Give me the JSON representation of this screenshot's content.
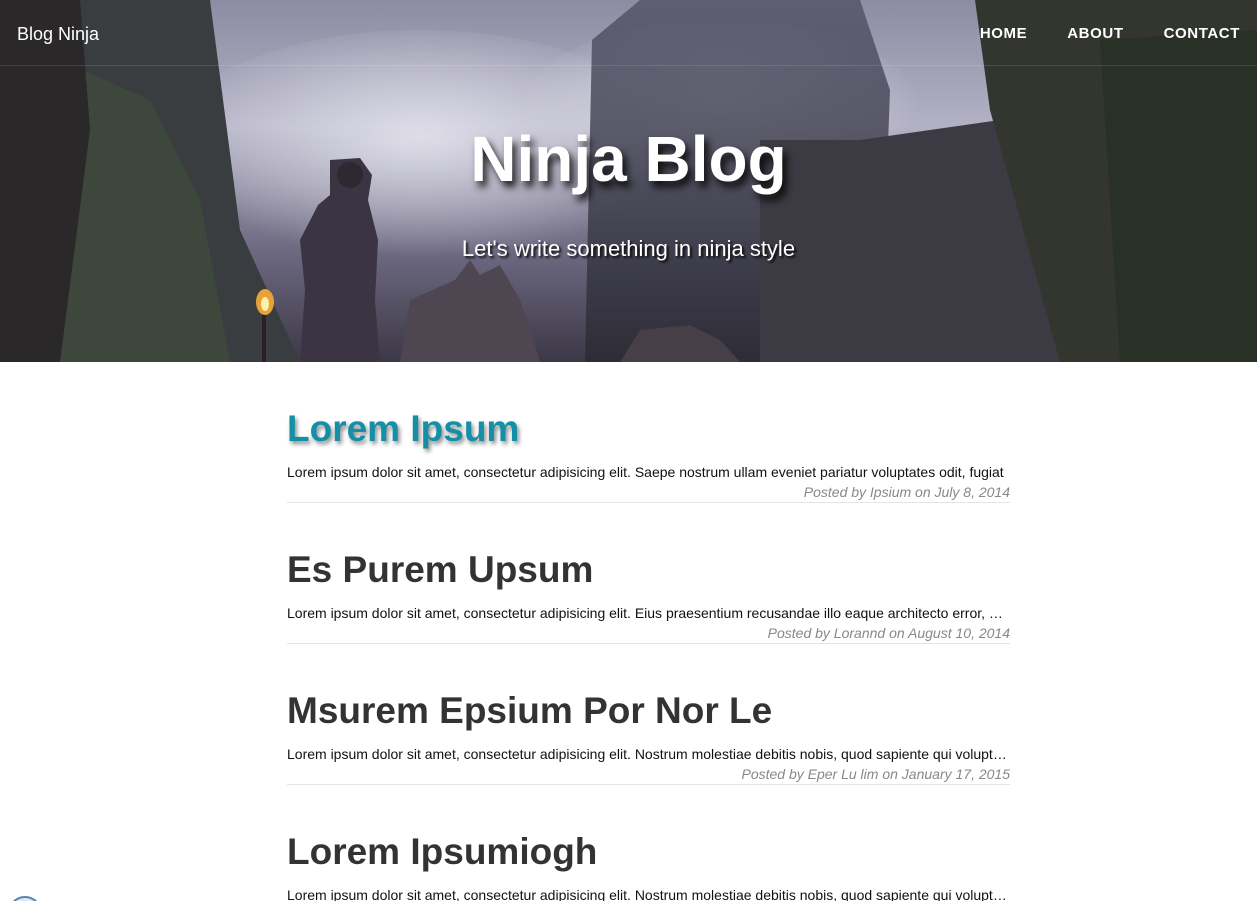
{
  "nav": {
    "brand": "Blog Ninja",
    "links": [
      "HOME",
      "ABOUT",
      "CONTACT"
    ]
  },
  "hero": {
    "title": "Ninja Blog",
    "subtitle": "Let's write something in ninja style"
  },
  "posts": [
    {
      "title": "Lorem Ipsum",
      "excerpt": "Lorem ipsum dolor sit amet, consectetur adipisicing elit. Saepe nostrum ullam eveniet pariatur voluptates odit, fugiat",
      "meta": "Posted by Ipsium on July 8, 2014",
      "active": true
    },
    {
      "title": "Es Purem Upsum",
      "excerpt": "Lorem ipsum dolor sit amet, consectetur adipisicing elit. Eius praesentium recusandae illo eaque architecto error, dolore",
      "meta": "Posted by Lorannd on August 10, 2014",
      "active": false
    },
    {
      "title": "Msurem Epsium Por Nor Le",
      "excerpt": "Lorem ipsum dolor sit amet, consectetur adipisicing elit. Nostrum molestiae debitis nobis, quod sapiente qui voluptatum",
      "meta": "Posted by Eper Lu lim on January 17, 2015",
      "active": false
    },
    {
      "title": "Lorem Ipsumiogh",
      "excerpt": "Lorem ipsum dolor sit amet, consectetur adipisicing elit. Nostrum molestiae debitis nobis, quod sapiente qui voluptatum",
      "meta": "",
      "active": false
    }
  ],
  "colors": {
    "accent": "#148fa6",
    "title_text": "#333333",
    "meta_text": "#888888",
    "divider": "#e5e5e5"
  },
  "icons": {
    "corner_widget": "circle-badge-icon"
  }
}
